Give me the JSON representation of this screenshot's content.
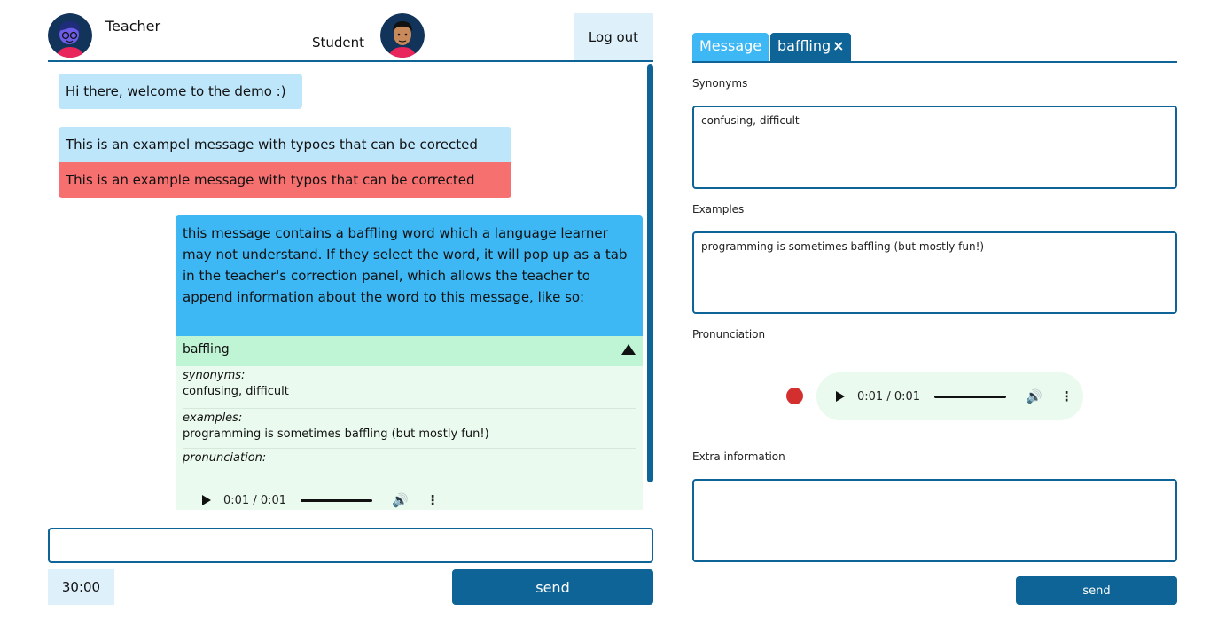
{
  "header": {
    "teacher_name": "Teacher",
    "student_name": "Student",
    "logout_label": "Log out"
  },
  "chat": {
    "messages": [
      {
        "text": "Hi there, welcome to the demo :)"
      },
      {
        "text": "This is an exampel message with typoes that can be corected"
      },
      {
        "text": "This is an example message with typos that can be corrected"
      },
      {
        "text": "this message contains a baffling word which a language learner may not understand. If they select the word, it will pop up as a tab in the teacher's correction panel, which allows the teacher to append information about the word to this message, like so:"
      }
    ],
    "word_card": {
      "word": "baffling",
      "synonyms_label": "synonyms:",
      "synonyms": "confusing, difficult",
      "examples_label": "examples:",
      "examples": "programming is sometimes baffling (but mostly fun!)",
      "pronunciation_label": "pronunciation:",
      "audio_time": "0:01 / 0:01"
    }
  },
  "composer": {
    "input_value": "",
    "timer": "30:00",
    "send_label": "send"
  },
  "panel": {
    "tabs": [
      {
        "label": "Message"
      },
      {
        "label": "baffling",
        "close": "×"
      }
    ],
    "synonyms_label": "Synonyms",
    "synonyms_value": "confusing, difficult",
    "examples_label": "Examples",
    "examples_value": "programming is sometimes baffling (but mostly fun!)",
    "pronunciation_label": "Pronunciation",
    "audio_time": "0:01 / 0:01",
    "extra_label": "Extra information",
    "extra_value": "",
    "send_label": "send"
  },
  "icons": {
    "play": "play-icon",
    "volume": "volume-icon",
    "more": "more-vertical-icon",
    "record": "record-icon",
    "collapse": "triangle-up-icon",
    "close": "close-icon"
  },
  "colors": {
    "primary": "#0e6496",
    "accent": "#3db8f5",
    "light_blue": "#bde6fb",
    "correction_red": "#f5706f",
    "word_green": "#bff5d4",
    "word_body_green": "#eafaef",
    "record_red": "#d32f2f"
  }
}
